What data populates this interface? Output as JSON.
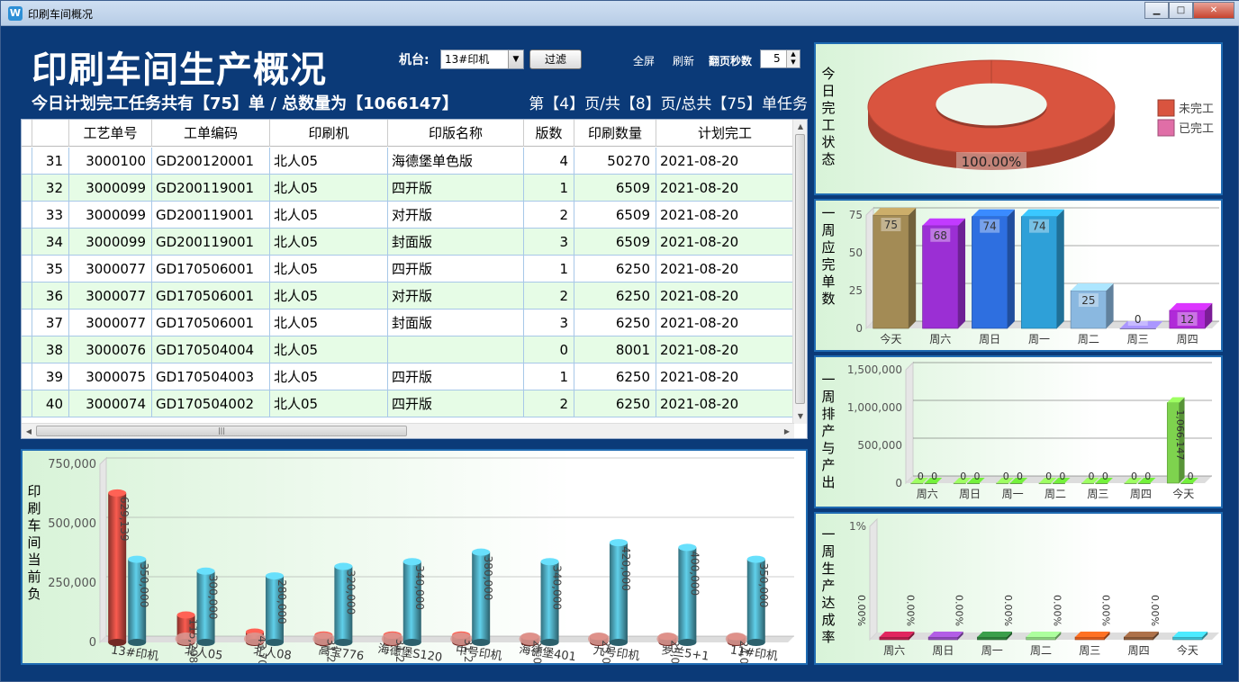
{
  "window": {
    "title": "印刷车间概况",
    "icon": "app-logo-icon",
    "minimize": "minimize-icon",
    "maximize": "maximize-icon",
    "close": "close-icon"
  },
  "header": {
    "title": "印刷车间生产概况",
    "subtitle": "今日计划完工任务共有【75】单 / 总数量为【1066147】",
    "page_info": "第【4】页/共【8】页/总共【75】单任务",
    "machine_label": "机台:",
    "machine_value": "13#印机",
    "filter_label": "过滤",
    "fullscreen_label": "全屏",
    "refresh_label": "刷新",
    "flip_label": "翻页秒数",
    "flip_value": "5"
  },
  "table": {
    "columns": [
      "工艺单号",
      "工单编码",
      "印刷机",
      "印版名称",
      "版数",
      "印刷数量",
      "计划完工"
    ],
    "rows": [
      [
        "31",
        "3000100",
        "GD200120001",
        "北人05",
        "海德堡单色版",
        "4",
        "50270",
        "2021-08-20"
      ],
      [
        "32",
        "3000099",
        "GD200119001",
        "北人05",
        "四开版",
        "1",
        "6509",
        "2021-08-20"
      ],
      [
        "33",
        "3000099",
        "GD200119001",
        "北人05",
        "对开版",
        "2",
        "6509",
        "2021-08-20"
      ],
      [
        "34",
        "3000099",
        "GD200119001",
        "北人05",
        "封面版",
        "3",
        "6509",
        "2021-08-20"
      ],
      [
        "35",
        "3000077",
        "GD170506001",
        "北人05",
        "四开版",
        "1",
        "6250",
        "2021-08-20"
      ],
      [
        "36",
        "3000077",
        "GD170506001",
        "北人05",
        "对开版",
        "2",
        "6250",
        "2021-08-20"
      ],
      [
        "37",
        "3000077",
        "GD170506001",
        "北人05",
        "封面版",
        "3",
        "6250",
        "2021-08-20"
      ],
      [
        "38",
        "3000076",
        "GD170504004",
        "北人05",
        "",
        "0",
        "8001",
        "2021-08-20"
      ],
      [
        "39",
        "3000075",
        "GD170504003",
        "北人05",
        "四开版",
        "1",
        "6250",
        "2021-08-20"
      ],
      [
        "40",
        "3000074",
        "GD170504002",
        "北人05",
        "四开版",
        "2",
        "6250",
        "2021-08-20"
      ]
    ]
  },
  "panels": {
    "today_status": "今日完工状态",
    "weekly_due": "一周应完单数",
    "weekly_output": "一周排产与产出",
    "weekly_rate": "一周生产达成率",
    "load": "印刷车间当前负"
  },
  "chart_data": [
    {
      "type": "pie",
      "id": "today-status",
      "categories": [
        "未完工",
        "已完工"
      ],
      "values": [
        100,
        0
      ],
      "labels": [
        "100.00%"
      ],
      "legend": "right",
      "colors": [
        "#d9543f",
        "#e06ea7"
      ]
    },
    {
      "type": "bar",
      "id": "weekly-due",
      "categories": [
        "今天",
        "周六",
        "周日",
        "周一",
        "周二",
        "周三",
        "周四"
      ],
      "values": [
        75,
        68,
        74,
        74,
        25,
        0,
        12
      ],
      "ylim": [
        0,
        75
      ],
      "yticks": [
        "0",
        "25",
        "50",
        "75"
      ],
      "colors": [
        "#a38b55",
        "#9b2fd4",
        "#2e6fe0",
        "#2ea0d8",
        "#8ab8e0",
        "#8878d0",
        "#b02ad8"
      ]
    },
    {
      "type": "bar",
      "id": "weekly-output",
      "categories": [
        "周六",
        "周日",
        "周一",
        "周二",
        "周三",
        "周四",
        "今天"
      ],
      "series": [
        {
          "values": [
            0,
            0,
            0,
            0,
            0,
            0,
            1066147
          ]
        },
        {
          "values": [
            0,
            0,
            0,
            0,
            0,
            0,
            0
          ]
        }
      ],
      "labels": [
        "0",
        "0",
        "0",
        "0",
        "0",
        "0",
        "1,066,147"
      ],
      "labels2": [
        "0",
        "0",
        "0",
        "0",
        "0",
        "0",
        "0"
      ],
      "ylim": [
        0,
        1500000
      ],
      "yticks": [
        "0",
        "500,000",
        "1,000,000",
        "1,500,000"
      ],
      "colors": [
        "#7ed34e",
        "#5cc12f"
      ]
    },
    {
      "type": "bar",
      "id": "weekly-rate",
      "categories": [
        "周六",
        "周日",
        "周一",
        "周二",
        "周三",
        "周四",
        "今天"
      ],
      "values": [
        0,
        0,
        0,
        0,
        0,
        0,
        0
      ],
      "labels": [
        "0.00%",
        "0.00%",
        "0.00%",
        "0.00%",
        "0.00%",
        "0.00%",
        "0.00%"
      ],
      "ylim": [
        0,
        1
      ],
      "yticks": [
        "1%"
      ],
      "colors": [
        "#b41f4c",
        "#8f4bb8",
        "#2f7f3c",
        "#8ad07e",
        "#d95a1c",
        "#8b5a3a",
        "#3dbcd0"
      ]
    },
    {
      "type": "bar",
      "id": "current-load",
      "categories": [
        "13#印机",
        "北人05",
        "北人08",
        "高宝776",
        "海德堡S120",
        "中号印机",
        "海德堡401",
        "九号印机",
        "罗兰5+1",
        "11#印机"
      ],
      "series": [
        {
          "name": "",
          "values": [
            629139,
            115298,
            43704,
            31250,
            31250,
            31250,
            25000,
            25000,
            25000,
            24000
          ],
          "labels": [
            "629,139",
            "115,298",
            "43,704",
            "31,250",
            "31,250",
            "31,250",
            "25,000",
            "25,000",
            "25,000",
            "24,000"
          ]
        },
        {
          "name": "",
          "values": [
            350000,
            300000,
            280000,
            320000,
            340000,
            380000,
            340000,
            420000,
            400000,
            350000
          ],
          "labels": [
            "350,000",
            "300,000",
            "280,000",
            "320,000",
            "340,000",
            "380,000",
            "340,000",
            "420,000",
            "400,000",
            "350,000"
          ]
        }
      ],
      "ylim": [
        0,
        750000
      ],
      "yticks": [
        "0",
        "250,000",
        "500,000",
        "750,000"
      ],
      "colors": [
        "#c0463d",
        "#4aa0b4"
      ]
    }
  ]
}
